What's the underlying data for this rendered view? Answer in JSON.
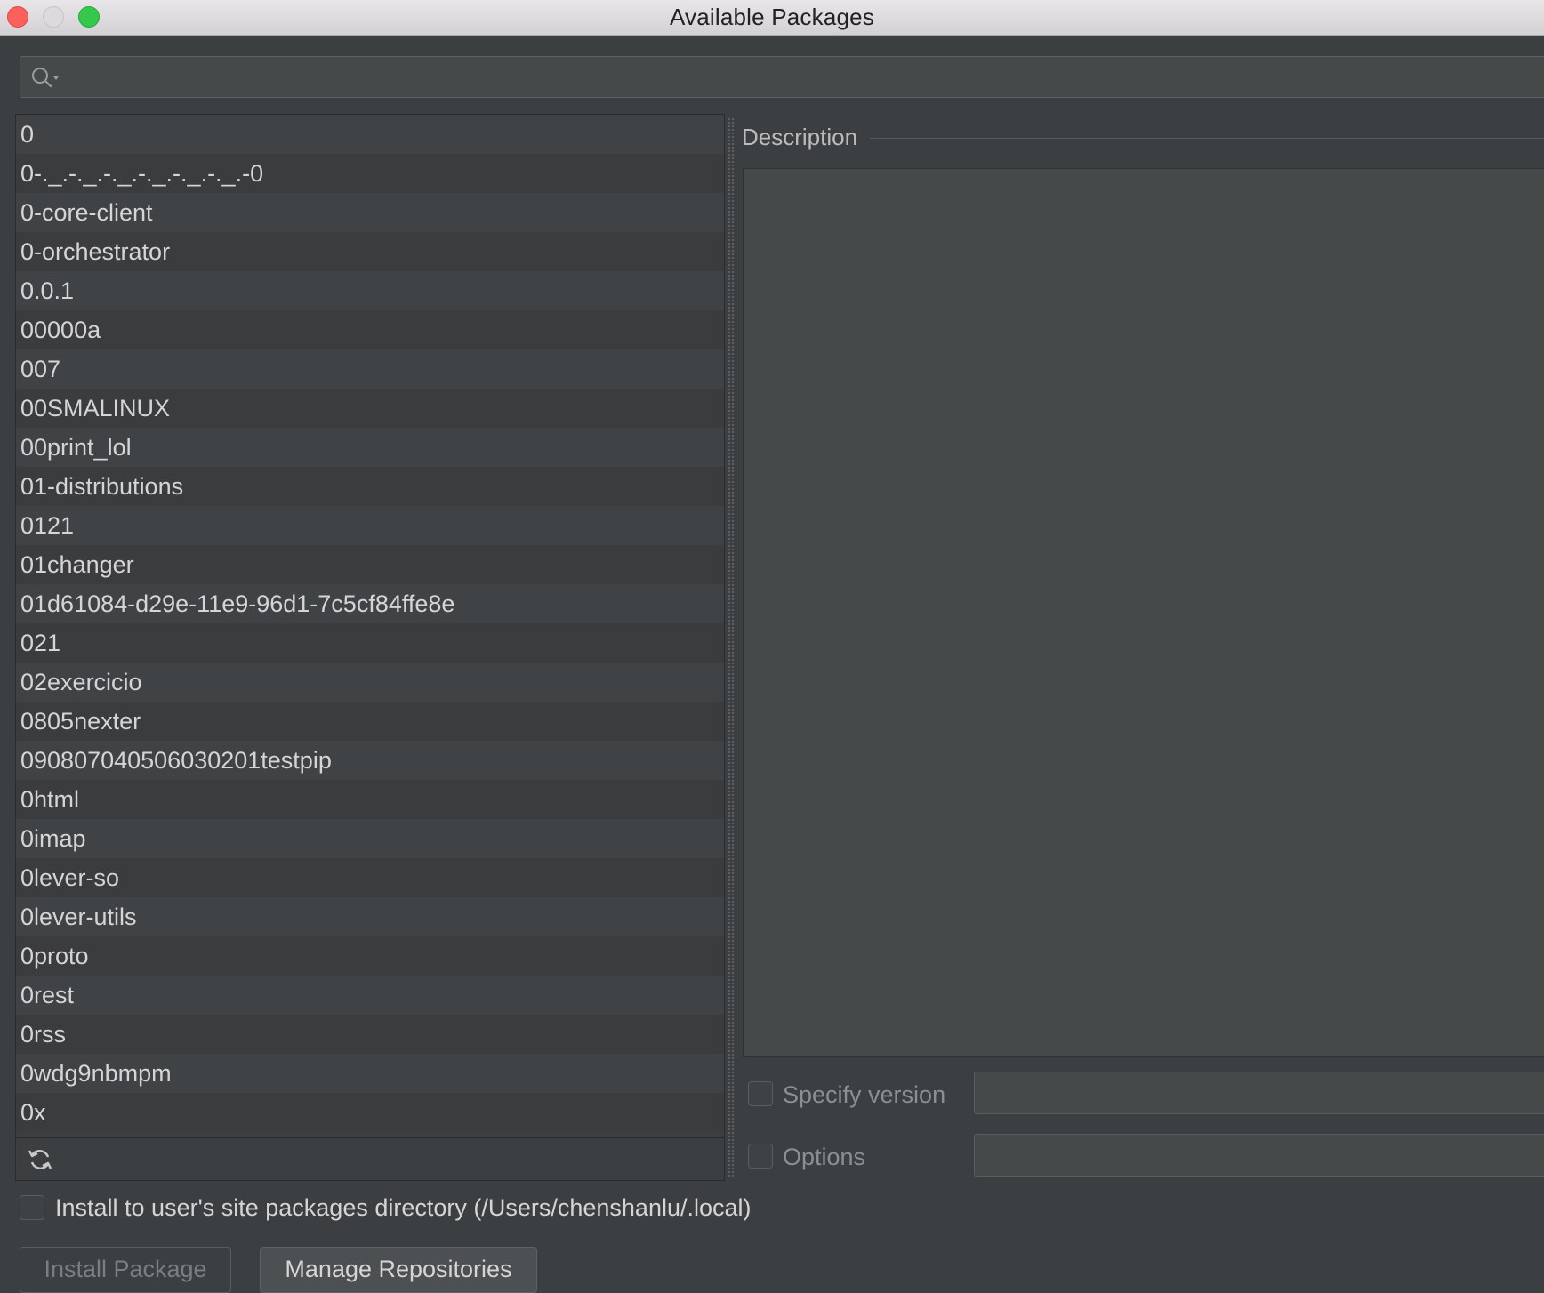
{
  "window": {
    "title": "Available Packages"
  },
  "search": {
    "value": "",
    "placeholder": ""
  },
  "packages": [
    "0",
    "0-._.-._.-._.-._.-._.-._.-0",
    "0-core-client",
    "0-orchestrator",
    "0.0.1",
    "00000a",
    "007",
    "00SMALINUX",
    "00print_lol",
    "01-distributions",
    "0121",
    "01changer",
    "01d61084-d29e-11e9-96d1-7c5cf84ffe8e",
    "021",
    "02exercicio",
    "0805nexter",
    "090807040506030201testpip",
    "0html",
    "0imap",
    "0lever-so",
    "0lever-utils",
    "0proto",
    "0rest",
    "0rss",
    "0wdg9nbmpm",
    "0x"
  ],
  "description": {
    "label": "Description",
    "text": ""
  },
  "specify_version": {
    "label": "Specify version",
    "checked": false,
    "value": ""
  },
  "options": {
    "label": "Options",
    "checked": false,
    "value": ""
  },
  "install_user_site": {
    "label": "Install to user's site packages directory (/Users/chenshanlu/.local)",
    "checked": false
  },
  "buttons": {
    "install": "Install Package",
    "manage": "Manage Repositories"
  },
  "icons": {
    "search": "search-icon",
    "refresh": "refresh-icon"
  },
  "colors": {
    "background": "#3c3f41",
    "text": "#d5d5d5",
    "muted": "#8c8f91"
  }
}
